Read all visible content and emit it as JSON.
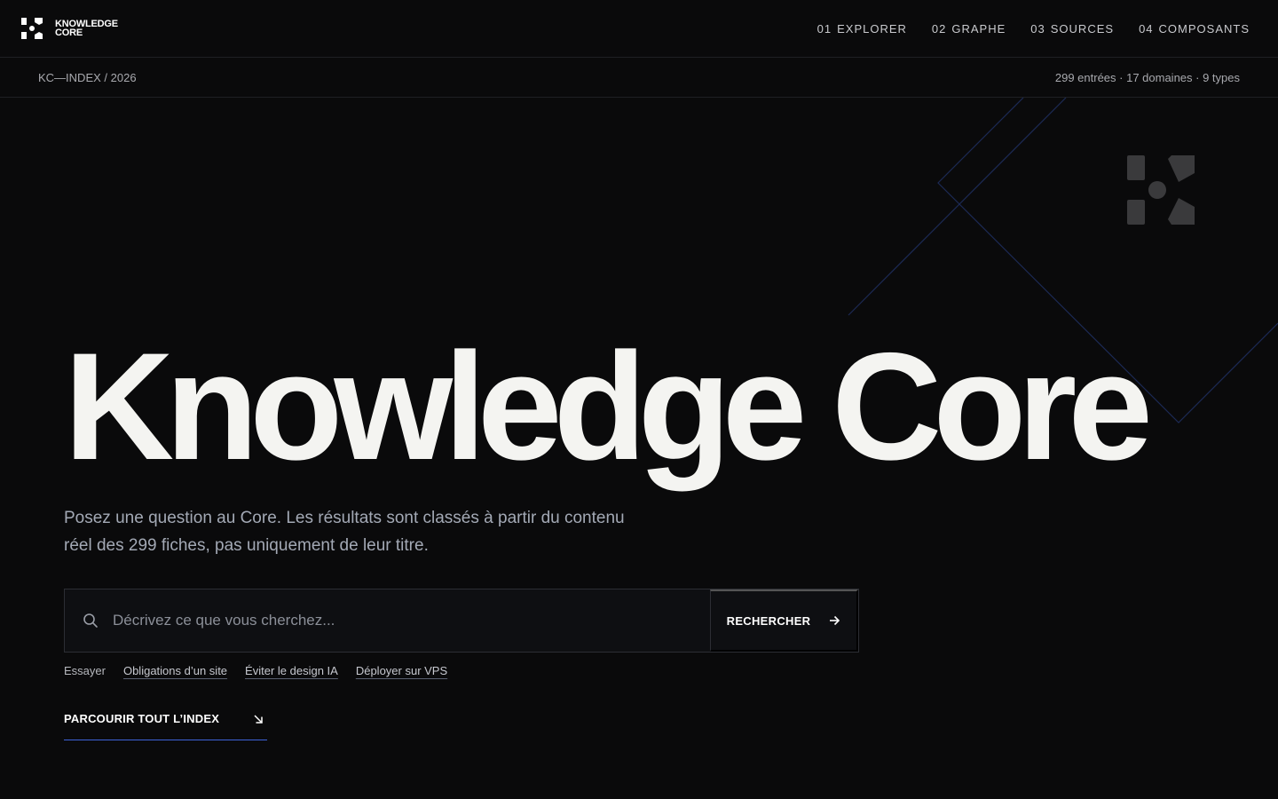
{
  "brand": {
    "line1": "KNOWLEDGE",
    "line2": "CORE"
  },
  "nav": [
    {
      "num": "01",
      "label": "EXPLORER"
    },
    {
      "num": "02",
      "label": "GRAPHE"
    },
    {
      "num": "03",
      "label": "SOURCES"
    },
    {
      "num": "04",
      "label": "COMPOSANTS"
    }
  ],
  "meta": {
    "index_label": "KC—INDEX / 2026",
    "stats": "299 entrées · 17 domaines · 9 types"
  },
  "hero": {
    "title": "Knowledge Core",
    "subtitle": "Posez une question au Core. Les résultats sont classés à partir du contenu réel des 299 fiches, pas uniquement de leur titre."
  },
  "search": {
    "placeholder": "Décrivez ce que vous cherchez...",
    "value": "",
    "button_label": "RECHERCHER"
  },
  "suggestions": {
    "label": "Essayer",
    "items": [
      "Obligations d’un site",
      "Éviter le design IA",
      "Déployer sur VPS"
    ]
  },
  "browse": {
    "label": "PARCOURIR TOUT L’INDEX"
  },
  "colors": {
    "background": "#0a0a0b",
    "accent": "#3d63d8",
    "deco_line": "#1c2a55",
    "text": "#f4f4f2",
    "muted": "#a3a9b5"
  },
  "icons": {
    "brand": "kc-logo-icon",
    "search": "search-icon",
    "search_button": "arrow-right-icon",
    "browse": "arrow-down-right-icon"
  }
}
